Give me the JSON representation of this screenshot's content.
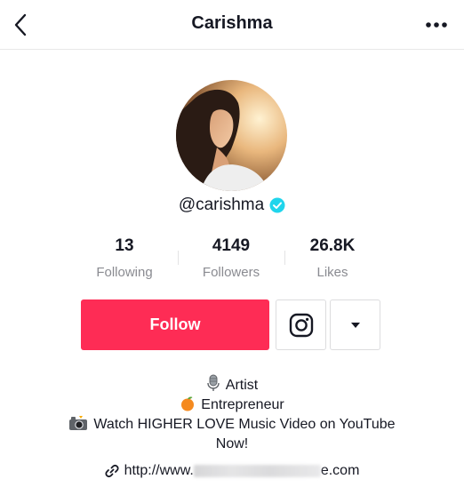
{
  "header": {
    "title": "Carishma",
    "back_icon": "chevron-left-icon",
    "more_icon": "more-dots-icon"
  },
  "profile": {
    "username": "@carishma",
    "verified": true,
    "verified_color": "#20d5ec"
  },
  "stats": [
    {
      "value": "13",
      "label": "Following"
    },
    {
      "value": "4149",
      "label": "Followers"
    },
    {
      "value": "26.8K",
      "label": "Likes"
    }
  ],
  "actions": {
    "follow_label": "Follow",
    "follow_color": "#fe2c55",
    "instagram_icon": "instagram-icon",
    "dropdown_icon": "caret-down-icon"
  },
  "bio": {
    "line1": "Artist",
    "line2": "Entrepreneur",
    "line3": "Watch HIGHER LOVE Music Video on YouTube",
    "line4": "Now!"
  },
  "link": {
    "prefix": "http://www.",
    "suffix": "e.com",
    "icon": "link-icon"
  }
}
